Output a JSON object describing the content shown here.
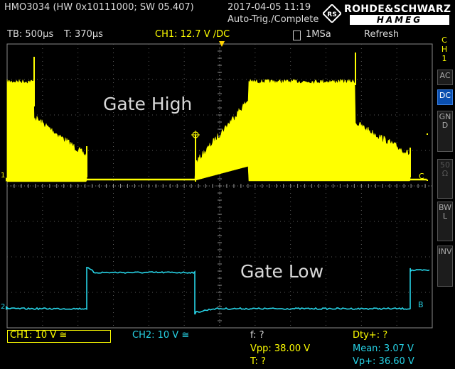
{
  "header": {
    "device": "HMO3034 (HW 0x10111000; SW 05.407)",
    "datetime": "2017-04-05 11:19",
    "trigger_status": "Auto-Trig./Complete",
    "logo_top": "ROHDE&SCHWARZ",
    "logo_bottom": "HAMEG"
  },
  "status": {
    "timebase": "TB: 500µs",
    "trigger_time": "T: 370µs",
    "ch1_trigger": "CH1: 12.7 V ∕DC",
    "sample_rate": "1MSa",
    "mode": "Refresh"
  },
  "annotations": {
    "gate_high": "Gate High",
    "gate_low": "Gate Low"
  },
  "markers": {
    "ch1_ref": "1",
    "ch2_ref": "2",
    "ch1_cursor": "C",
    "ch2_cursor": "B"
  },
  "side_panel": {
    "channel": "CH1",
    "buttons": [
      "AC",
      "DC",
      "GND",
      "50Ω",
      "BWL",
      "INV"
    ],
    "active": "DC"
  },
  "measurements": {
    "ch1_setting": "CH1: 10 V ≅",
    "ch2_setting": "CH2: 10 V ≅",
    "freq": "f: ?",
    "vpp": "Vpp: 38.00 V",
    "period": "T: ?",
    "dty": "Dty+: ?",
    "mean": "Mean: 3.07 V",
    "vp_plus": "Vp+: 36.60 V"
  },
  "colors": {
    "ch1": "#ffff00",
    "ch2": "#27d3e6",
    "annotation": "#e0202a",
    "accent": "#ffd200"
  }
}
